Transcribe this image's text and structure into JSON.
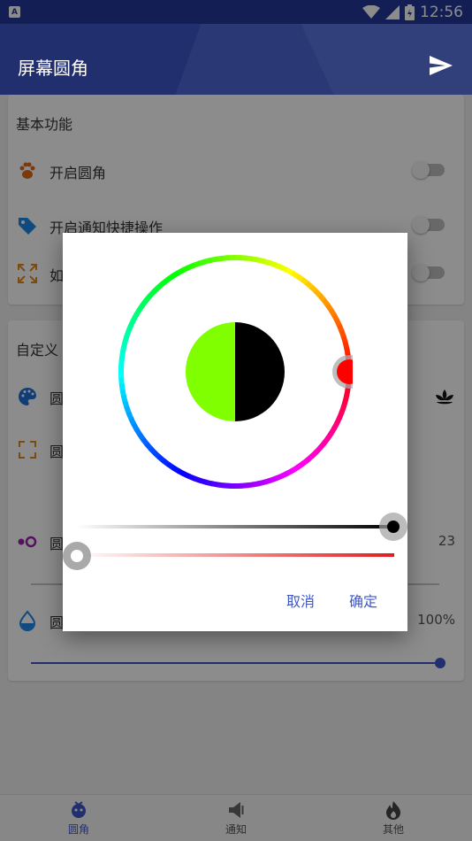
{
  "status_bar": {
    "time": "12:56",
    "app_badge": "A"
  },
  "app_bar": {
    "title": "屏幕圆角"
  },
  "basic_card": {
    "title": "基本功能",
    "items": [
      {
        "label": "开启圆角",
        "icon": "paw-icon"
      },
      {
        "label": "开启通知快捷操作",
        "icon": "tag-icon"
      },
      {
        "label": "如",
        "icon": "expand-icon"
      }
    ]
  },
  "custom_card": {
    "title": "自定义",
    "rows": [
      {
        "label": "圆",
        "icon": "palette-icon"
      },
      {
        "label": "圆",
        "icon": "corner-frame-icon"
      },
      {
        "label": "圆",
        "icon": "dots-icon",
        "value": "23"
      },
      {
        "label": "圆",
        "icon": "drop-icon",
        "value": "100%"
      }
    ]
  },
  "color_dialog": {
    "selected_color": "#7fff00",
    "previous_color": "#000000",
    "hue_marker_color": "#ff0000",
    "value_level": 1.0,
    "alpha_level": 0.0,
    "cancel_label": "取消",
    "ok_label": "确定"
  },
  "bottom_nav": [
    {
      "label": "圆角",
      "active": true
    },
    {
      "label": "通知",
      "active": false
    },
    {
      "label": "其他",
      "active": false
    }
  ]
}
